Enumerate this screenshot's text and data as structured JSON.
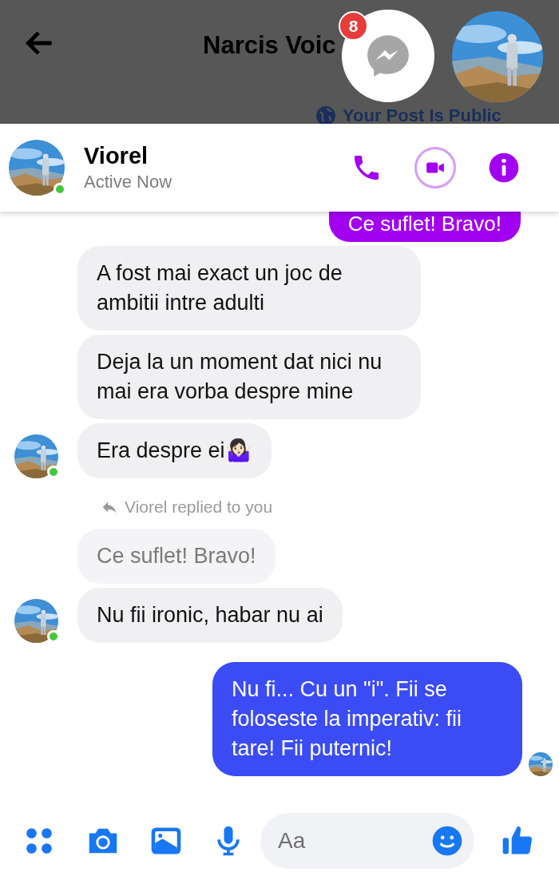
{
  "top_bar": {
    "title": "Narcis Voic",
    "notice": "Your Post Is Public"
  },
  "chat_head": {
    "badge": "8"
  },
  "header": {
    "name": "Viorel",
    "status": "Active Now",
    "online": true
  },
  "messages": [
    {
      "kind": "sent",
      "text": "Ce suflet! Bravo!"
    },
    {
      "kind": "received",
      "text": "A fost mai exact un joc de ambitii intre adulti"
    },
    {
      "kind": "received",
      "text": "Deja la un moment dat nici nu mai era vorba despre mine"
    },
    {
      "kind": "received",
      "text": "Era despre ei🤷🏻‍♀️",
      "avatar": true
    },
    {
      "kind": "reply_note",
      "text": "Viorel replied to you"
    },
    {
      "kind": "quoted",
      "text": "Ce suflet! Bravo!"
    },
    {
      "kind": "received",
      "text": "Nu fii ironic, habar nu ai",
      "avatar": true
    },
    {
      "kind": "sent_blue",
      "text": "Nu fi... Cu un \"i\". Fii se foloseste la imperativ: fii tare! Fii puternic!",
      "avatar": true
    }
  ],
  "composer": {
    "placeholder": "Aa"
  }
}
